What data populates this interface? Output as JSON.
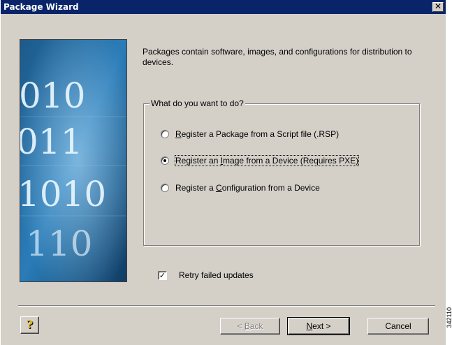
{
  "window": {
    "title": "Package Wizard",
    "close_glyph": "✕"
  },
  "intro_text": "Packages contain software, images, and configurations for distribution to devices.",
  "group": {
    "legend": "What do you want to do?",
    "options": [
      {
        "pre": "",
        "key": "R",
        "post": "egister a Package from a Script file (.RSP)",
        "checked": false
      },
      {
        "pre": "Register an ",
        "key": "I",
        "post": "mage from a Device (Requires PXE)",
        "checked": true
      },
      {
        "pre": "Register a ",
        "key": "C",
        "post": "onfiguration from a Device",
        "checked": false
      }
    ]
  },
  "retry_checkbox": {
    "label": "Retry failed updates",
    "checked": true,
    "mark": "✓"
  },
  "buttons": {
    "help_glyph": "?",
    "back_glyph": "< ",
    "back_key": "B",
    "back_rest": "ack",
    "next_key": "N",
    "next_rest": "ext >",
    "cancel": "Cancel"
  },
  "side_image_digits": [
    "010",
    "011",
    "1010",
    "110"
  ],
  "side_id": "342110",
  "colors": {
    "titlebar": "#0a246a",
    "dialog_bg": "#d4d0c8"
  }
}
